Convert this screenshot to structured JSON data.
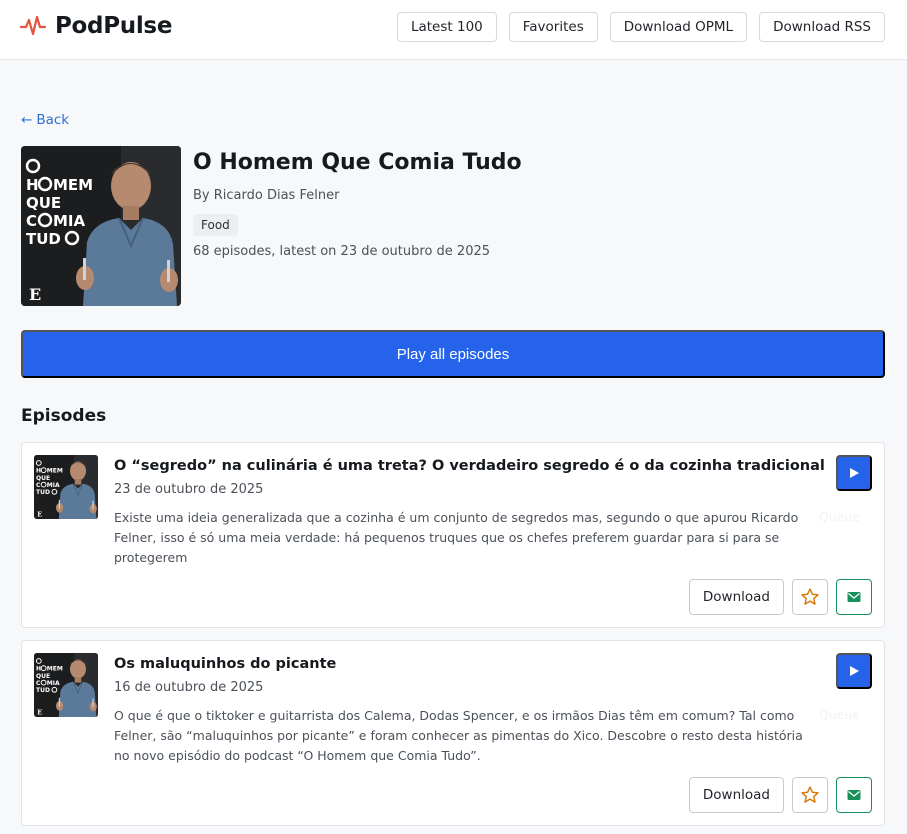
{
  "brand": {
    "name": "PodPulse",
    "icon": "pulse-icon",
    "accent": "#e5533c"
  },
  "nav": {
    "latest_label": "Latest 100",
    "favorites_label": "Favorites",
    "opml_label": "Download OPML",
    "rss_label": "Download RSS"
  },
  "back": {
    "arrow": "←",
    "label": "Back"
  },
  "podcast": {
    "title": "O Homem Que Comia Tudo",
    "author": "By Ricardo Dias Felner",
    "category": "Food",
    "meta": "68 episodes, latest on 23 de outubro de 2025",
    "artwork_text": [
      "O",
      "HOMEM",
      "QUE",
      "COMIA",
      "TUDO",
      "E"
    ]
  },
  "play_all_label": "Play all episodes",
  "episodes_heading": "Episodes",
  "episodes": [
    {
      "title": "O “segredo” na culinária é uma treta? O verdadeiro segredo é o da cozinha tradicional",
      "date": "23 de outubro de 2025",
      "description": "Existe uma ideia generalizada que a cozinha é um conjunto de segredos mas, segundo o que apurou Ricardo Felner, isso é só uma meia verdade: há pequenos truques que os chefes preferem guardar para si para se protegerem",
      "queue_label": "Queue",
      "download_label": "Download"
    },
    {
      "title": "Os maluquinhos do picante",
      "date": "16 de outubro de 2025",
      "description": "O que é que o tiktoker e guitarrista dos Calema, Dodas Spencer, e os irmãos Dias têm em comum? Tal como Felner, são “maluquinhos por picante” e foram conhecer as pimentas do Xico. Descobre o resto desta história no novo episódio do podcast “O Homem que Comia Tudo”.",
      "queue_label": "Queue",
      "download_label": "Download"
    }
  ],
  "colors": {
    "primary": "#2563eb",
    "star": "#d97706",
    "mail": "#17905a",
    "link": "#2f6fd1"
  }
}
